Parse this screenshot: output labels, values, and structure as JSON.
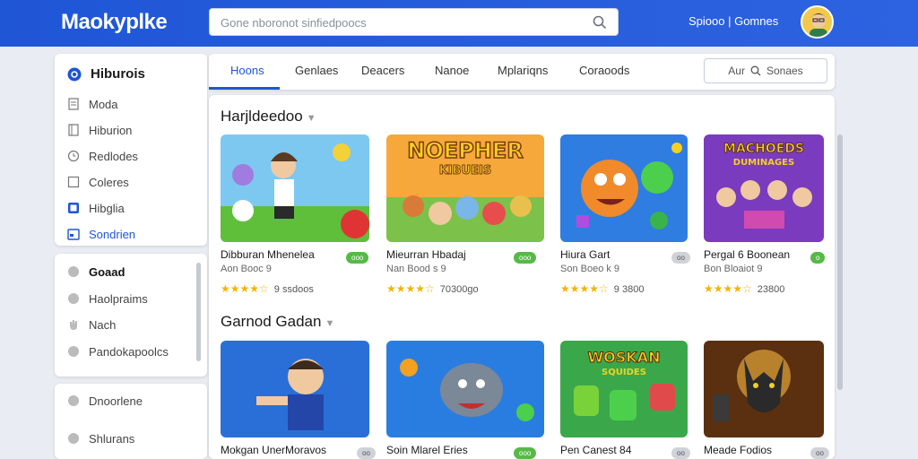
{
  "app": {
    "title": "Maokyplke"
  },
  "search": {
    "placeholder": "Gone nboronot sinfiedpoocs"
  },
  "account": {
    "label": "Spiooo | Gomnes"
  },
  "sidebar": {
    "group1": {
      "title": "Hiburois",
      "items": [
        {
          "label": "Moda",
          "icon": "document-icon"
        },
        {
          "label": "Hiburion",
          "icon": "book-icon"
        },
        {
          "label": "Redlodes",
          "icon": "clock-icon"
        },
        {
          "label": "Coleres",
          "icon": "square-icon"
        },
        {
          "label": "Hibglia",
          "icon": "image-icon"
        },
        {
          "label": "Sondrien",
          "icon": "calendar-icon"
        }
      ]
    },
    "group2": {
      "items": [
        {
          "label": "Goaad",
          "icon": "circle-icon"
        },
        {
          "label": "Haolpraims",
          "icon": "circle-icon"
        },
        {
          "label": "Nach",
          "icon": "hand-icon"
        },
        {
          "label": "Pandokapoolcs",
          "icon": "circle-icon"
        }
      ]
    },
    "group3": {
      "items": [
        {
          "label": "Dnoorlene",
          "icon": "circle-icon"
        },
        {
          "label": "Shlurans",
          "icon": "circle-icon"
        }
      ]
    }
  },
  "tabs": [
    {
      "label": "Hoons"
    },
    {
      "label": "Genlaes"
    },
    {
      "label": "Deacers"
    },
    {
      "label": "Nanoe"
    },
    {
      "label": "Mplariqns"
    },
    {
      "label": "Coraoods"
    }
  ],
  "filter_button": {
    "label": "Aur",
    "label2": "Sonaes"
  },
  "sections": [
    {
      "title": "Harjldeedoo",
      "cards": [
        {
          "name": "Dibburan Mhenelea",
          "sub": "Aon Booc 9",
          "badge": "ooo",
          "stars": "★★★★☆",
          "count": "9 ssdoos"
        },
        {
          "name": "Mieurran Hbadaj",
          "sub": "Nan Bood s 9",
          "badge": "ooo",
          "stars": "★★★★☆",
          "count": "70300go"
        },
        {
          "name": "Hiura Gart",
          "sub": "Son Boeo k 9",
          "badge": "oo",
          "stars": "★★★★☆",
          "count": "9 3800"
        },
        {
          "name": "Pergal 6 Boonean",
          "sub": "Bon Bloaiot 9",
          "badge": "o",
          "stars": "★★★★☆",
          "count": "23800"
        }
      ]
    },
    {
      "title": "Garnod Gadan",
      "cards": [
        {
          "name": "Mokgan UnerMoravos",
          "sub": "",
          "badge": "oo",
          "stars": "",
          "count": ""
        },
        {
          "name": "Soin Mlarel Eries",
          "sub": "",
          "badge": "ooo",
          "stars": "",
          "count": ""
        },
        {
          "name": "Pen Canest 84",
          "sub": "",
          "badge": "oo",
          "stars": "",
          "count": ""
        },
        {
          "name": "Meade Fodios",
          "sub": "",
          "badge": "oo",
          "stars": "",
          "count": ""
        }
      ]
    }
  ],
  "colors": {
    "brand": "#1f56d6",
    "badge_green": "#57b947",
    "star": "#f4b400"
  }
}
